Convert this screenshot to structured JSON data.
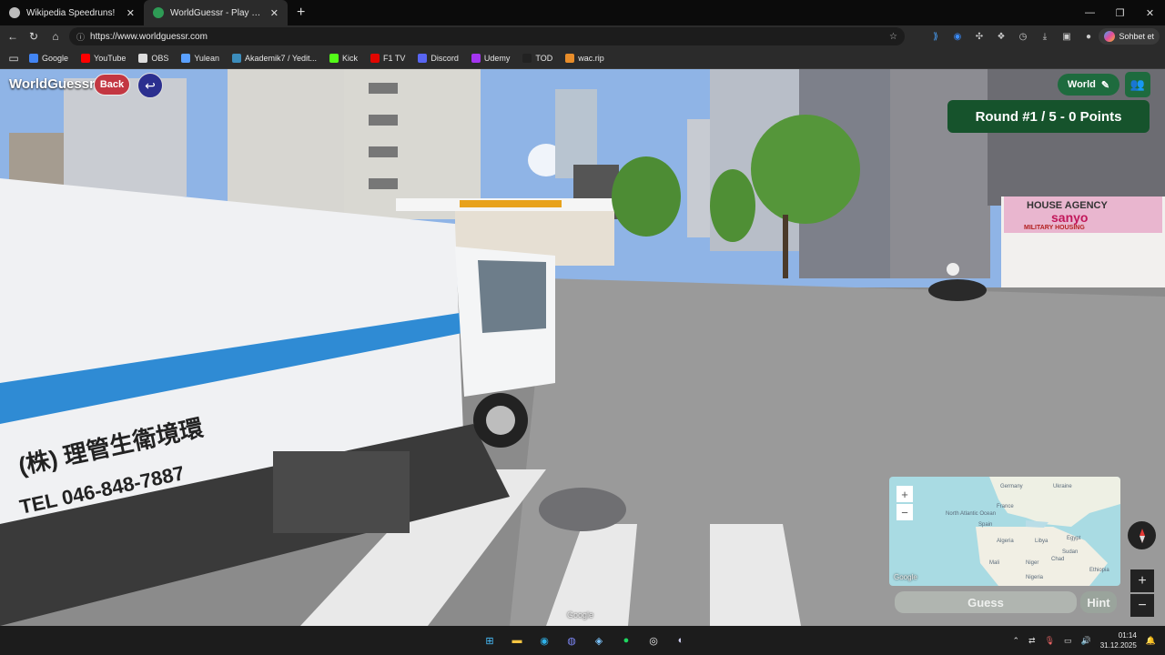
{
  "browser": {
    "tabs": [
      {
        "title": "Wikipedia Speedruns!",
        "active": false
      },
      {
        "title": "WorldGuessr - Play Geoguessr for Free",
        "active": true
      }
    ],
    "new_tab": "+",
    "window_controls": [
      "—",
      "❐",
      "✕"
    ],
    "url": "https://www.worldguessr.com",
    "profile_button": "Sohbet et",
    "bookmarks": [
      {
        "label": "Google",
        "color": "#4285f4"
      },
      {
        "label": "YouTube",
        "color": "#ff0000"
      },
      {
        "label": "OBS",
        "color": "#dddddd"
      },
      {
        "label": "Yulean",
        "color": "#5aa0ff"
      },
      {
        "label": "Akademik7 / Yedit...",
        "color": "#3c8dbc"
      },
      {
        "label": "Kick",
        "color": "#53fc18"
      },
      {
        "label": "F1 TV",
        "color": "#e10600"
      },
      {
        "label": "Discord",
        "color": "#5865f2"
      },
      {
        "label": "Udemy",
        "color": "#a435f0"
      },
      {
        "label": "TOD",
        "color": "#222222"
      },
      {
        "label": "wac.rip",
        "color": "#e88d2a"
      }
    ]
  },
  "game": {
    "logo": "WorldGuessr",
    "back_label": "Back",
    "mode_label": "World",
    "round_text": "Round #1 / 5 - 0 Points",
    "guess_label": "Guess",
    "hint_label": "Hint",
    "zoom_in": "+",
    "zoom_out": "−",
    "google_mark": "Google",
    "map_labels": [
      "North Atlantic Ocean",
      "Germany",
      "Ukraine",
      "France",
      "Spain",
      "Algeria",
      "Libya",
      "Egypt",
      "Mali",
      "Niger",
      "Chad",
      "Sudan",
      "Nigeria",
      "Ethiopia"
    ]
  },
  "scene": {
    "truck_text_1": "(株) 理管生衛境環",
    "truck_text_2": "TEL 046-848-7887",
    "shop_sign_1": "HOUSE AGENCY",
    "shop_sign_2": "sanyo",
    "shop_sign_3": "MILITARY HOUSING"
  },
  "taskbar": {
    "time": "01:14",
    "date": "31.12.2025"
  },
  "colors": {
    "accent_green": "#16532c",
    "back_red": "#c33742",
    "undo_blue": "#2b2f8f"
  }
}
